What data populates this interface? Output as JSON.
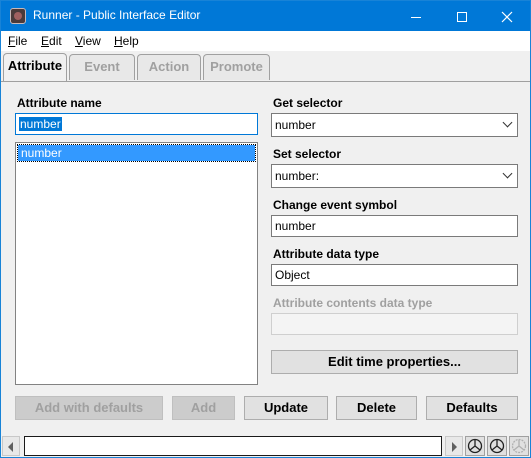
{
  "window": {
    "title": "Runner - Public Interface Editor"
  },
  "menu": [
    {
      "key": "F",
      "rest": "ile"
    },
    {
      "key": "E",
      "rest": "dit"
    },
    {
      "key": "V",
      "rest": "iew"
    },
    {
      "key": "H",
      "rest": "elp"
    }
  ],
  "tabs": [
    "Attribute",
    "Event",
    "Action",
    "Promote"
  ],
  "left": {
    "attribute_name_label": "Attribute name",
    "attribute_name_value": "number",
    "list_items": [
      "number"
    ]
  },
  "right": {
    "get_selector_label": "Get selector",
    "get_selector_value": "number",
    "set_selector_label": "Set selector",
    "set_selector_value": "number:",
    "change_event_label": "Change event symbol",
    "change_event_value": "number",
    "data_type_label": "Attribute data type",
    "data_type_value": "Object",
    "contents_type_label": "Attribute contents data type",
    "contents_type_value": "",
    "edit_time_label": "Edit time properties..."
  },
  "buttons": {
    "add_with_defaults": "Add with defaults",
    "add": "Add",
    "update": "Update",
    "delete": "Delete",
    "defaults": "Defaults"
  },
  "statusbar": {
    "icons": [
      "workspace-icon",
      "workspace-icon",
      "workspace-icon-disabled"
    ]
  },
  "colors": {
    "titlebar": "#0078d7",
    "selection": "#3399ff"
  }
}
